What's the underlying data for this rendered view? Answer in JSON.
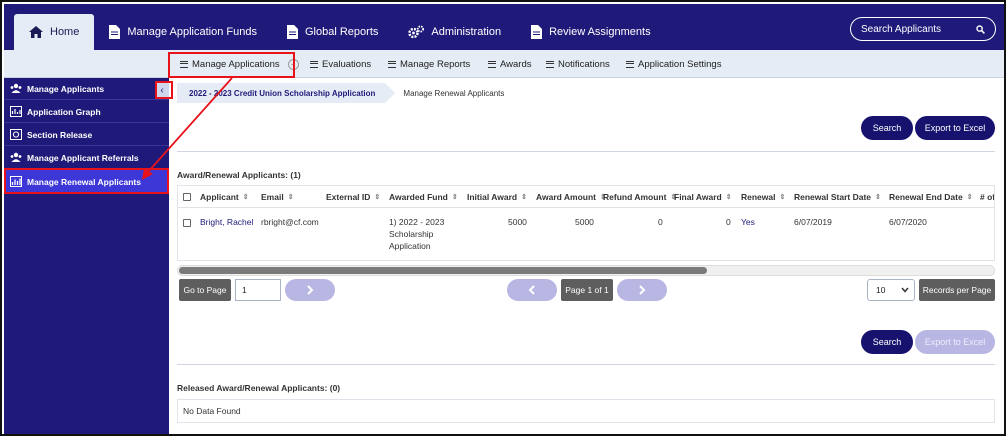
{
  "topnav": {
    "items": [
      {
        "label": "Home",
        "icon": "home-icon"
      },
      {
        "label": "Manage Application Funds",
        "icon": "document-icon"
      },
      {
        "label": "Global Reports",
        "icon": "document-icon"
      },
      {
        "label": "Administration",
        "icon": "gears-icon"
      },
      {
        "label": "Review Assignments",
        "icon": "document-icon"
      }
    ],
    "search_label": "Search Applicants"
  },
  "subnav": {
    "items": [
      "Manage Applications",
      "Evaluations",
      "Manage Reports",
      "Awards",
      "Notifications",
      "Application Settings"
    ]
  },
  "sidebar": {
    "items": [
      {
        "label": "Manage Applicants"
      },
      {
        "label": "Application Graph"
      },
      {
        "label": "Section Release"
      },
      {
        "label": "Manage Applicant Referrals"
      },
      {
        "label": "Manage Renewal Applicants"
      }
    ]
  },
  "breadcrumb": {
    "first": "2022 - 2023 Credit Union Scholarship Application",
    "second": "Manage Renewal Applicants"
  },
  "buttons": {
    "search": "Search",
    "export": "Export to Excel"
  },
  "awards_table": {
    "title": "Award/Renewal Applicants: (1)",
    "columns": [
      "Applicant",
      "Email",
      "External ID",
      "Awarded Fund",
      "Initial Award",
      "Award Amount",
      "Refund Amount",
      "Final Award",
      "Renewal",
      "Renewal Start Date",
      "Renewal End Date",
      "# of"
    ],
    "rows": [
      {
        "applicant": "Bright, Rachel",
        "email": "rbright@cf.com",
        "external_id": "",
        "fund_line1": "1) 2022 - 2023",
        "fund_line2": "Scholarship",
        "fund_line3": "Application",
        "initial_award": "5000",
        "award_amount": "5000",
        "refund_amount": "0",
        "final_award": "0",
        "renewal": "Yes",
        "renewal_start": "6/07/2019",
        "renewal_end": "6/07/2020"
      }
    ]
  },
  "pager": {
    "go_to_page": "Go to Page",
    "page_value": "1",
    "page_info": "Page 1 of 1",
    "per_page_value": "10",
    "records_per_page": "Records per Page"
  },
  "released_table": {
    "title": "Released Award/Renewal Applicants: (0)",
    "empty": "No Data Found"
  },
  "colors": {
    "navy": "#1f1a7a",
    "active_sidebar": "#3c37d6",
    "highlight_red": "#e8121b"
  }
}
